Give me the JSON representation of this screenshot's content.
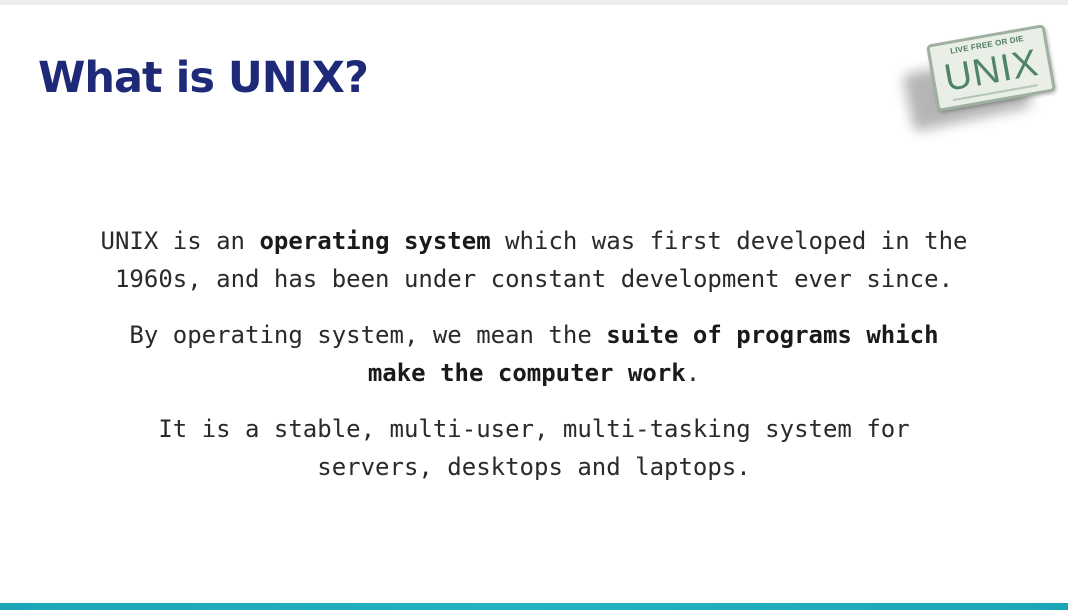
{
  "slide": {
    "title": "What is UNIX?",
    "logo": {
      "top_text": "LIVE FREE OR DIE",
      "main_text": "UNIX"
    },
    "paragraphs": [
      {
        "line1": {
          "pre": "UNIX is an ",
          "bold": "operating system",
          "post": " which was first developed in the"
        },
        "line2": "1960s, and has been under constant development ever since."
      },
      {
        "line1": {
          "pre": "By operating system, we mean the ",
          "bold": "suite of programs which"
        },
        "line2": {
          "bold": "make the computer work",
          "post": "."
        }
      },
      {
        "line1": "It is a stable, multi-user, multi-tasking system for",
        "line2": "servers, desktops and laptops."
      }
    ],
    "colors": {
      "title": "#1e2a78",
      "accent_bar": "#1aa6b7",
      "plate_text": "#4e8468"
    }
  }
}
